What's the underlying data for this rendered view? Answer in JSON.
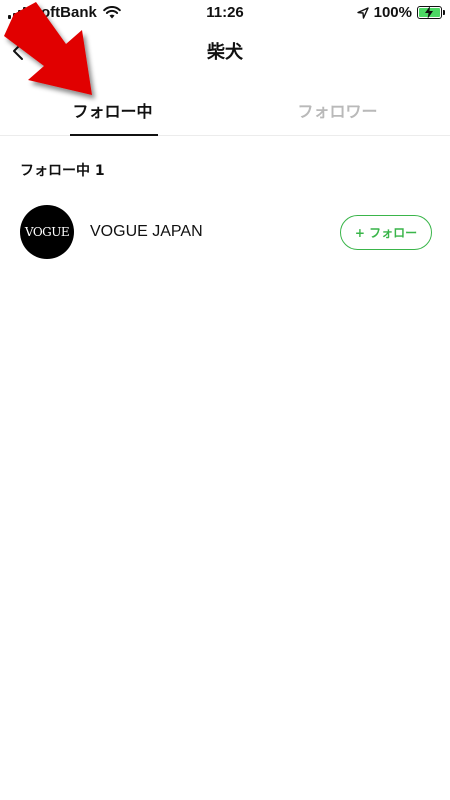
{
  "status_bar": {
    "carrier": "SoftBank",
    "time": "11:26",
    "battery": "100%",
    "battery_color": "#4cd964"
  },
  "nav": {
    "title": "柴犬",
    "back_icon": "chevron-left-icon"
  },
  "tabs": [
    {
      "label": "フォロー中",
      "active": true
    },
    {
      "label": "フォロワー",
      "active": false
    }
  ],
  "section": {
    "heading": "フォロー中 1",
    "items": [
      {
        "avatar_text": "VOGUE",
        "name": "VOGUE JAPAN",
        "button": "+ フォロー"
      }
    ]
  },
  "colors": {
    "accent_green": "#3ab54a",
    "annotation_red": "#e10000"
  }
}
